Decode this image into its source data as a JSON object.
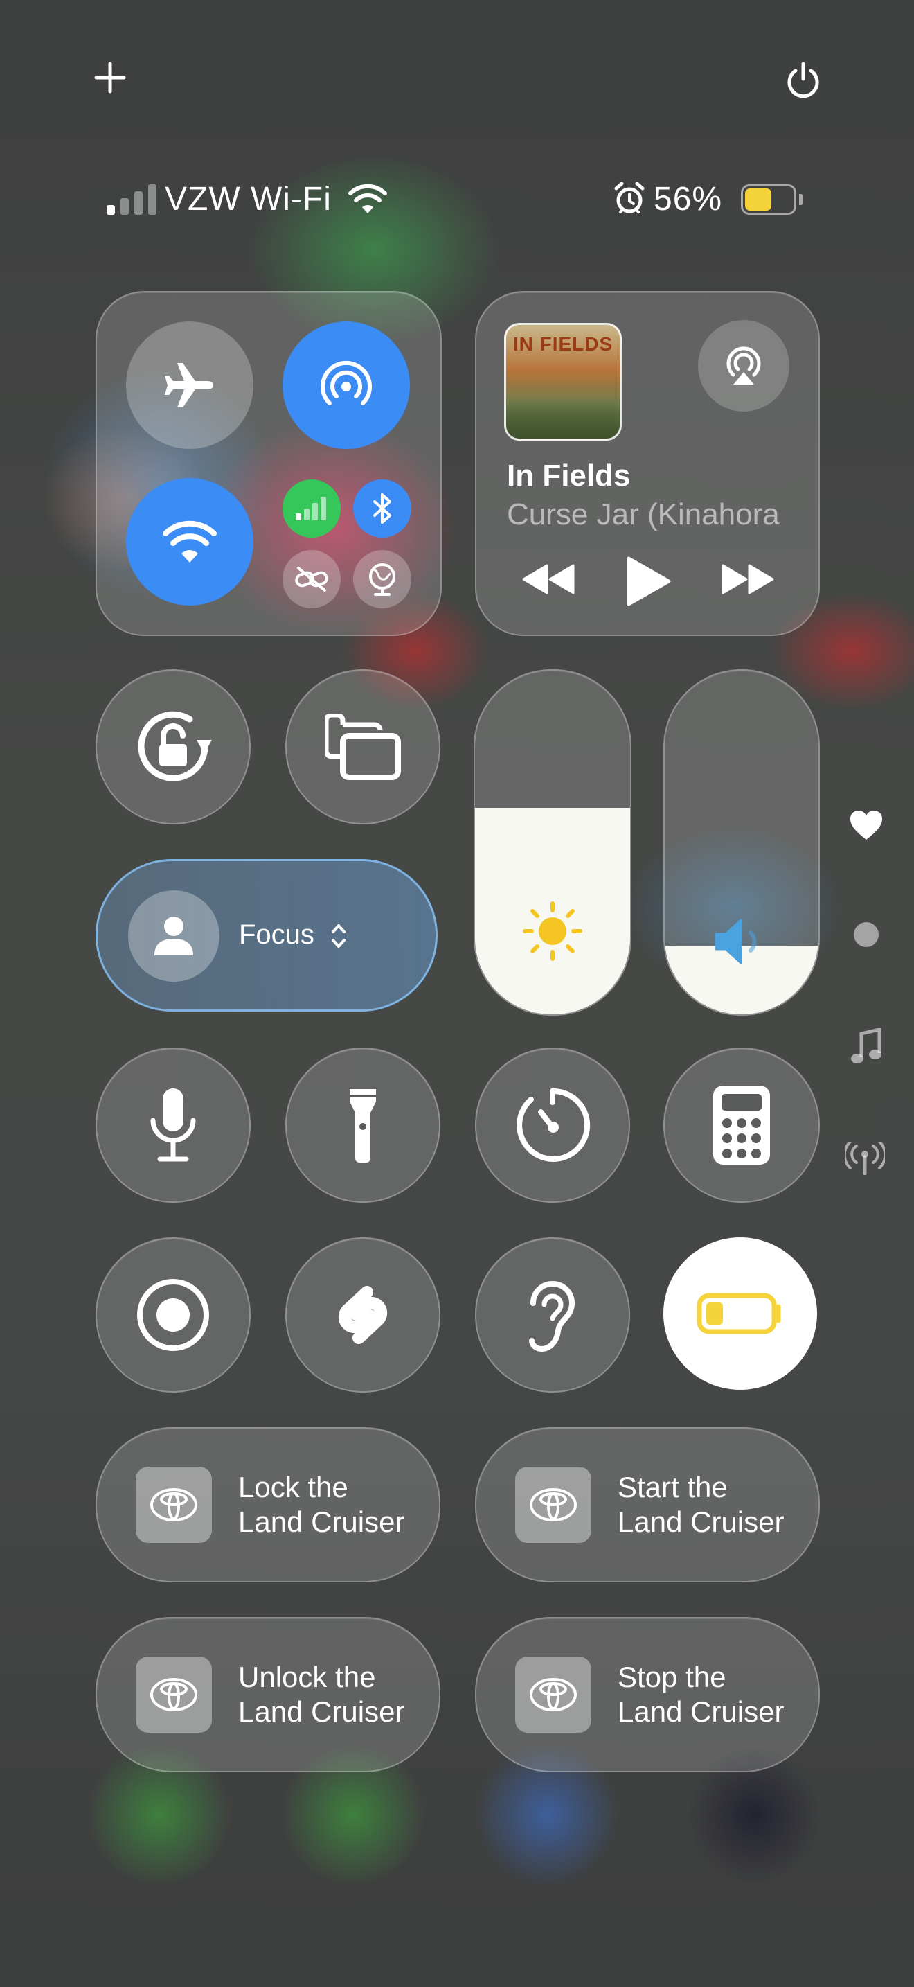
{
  "status_bar": {
    "carrier": "VZW Wi-Fi",
    "battery_percent": "56%",
    "signal_bars_filled": 1,
    "signal_bars_total": 4,
    "battery_level": 0.56,
    "battery_color": "#f5d33a"
  },
  "connectivity": {
    "airplane_mode": false,
    "airdrop_on": true,
    "wifi_on": true,
    "cellular_on": true,
    "bluetooth_on": true,
    "active_color": "#3c8cf5",
    "cellular_color": "#35c759"
  },
  "now_playing": {
    "title": "In Fields",
    "artist": "Curse Jar (Kinahora",
    "album_art_text": "IN FIELDS"
  },
  "focus": {
    "label": "Focus"
  },
  "brightness": {
    "level": 0.6
  },
  "volume": {
    "level": 0.2
  },
  "right_rail": {
    "icons": [
      "heart-icon",
      "dot-icon",
      "music-note-icon",
      "antenna-icon"
    ]
  },
  "shortcuts": {
    "lock": {
      "line1": "Lock the",
      "line2": "Land Cruiser"
    },
    "start": {
      "line1": "Start the",
      "line2": "Land Cruiser"
    },
    "unlock": {
      "line1": "Unlock the",
      "line2": "Land Cruiser"
    },
    "stop": {
      "line1": "Stop the",
      "line2": "Land Cruiser"
    }
  },
  "controls": {
    "low_power_on": true,
    "accent_yellow": "#f5d33a"
  }
}
